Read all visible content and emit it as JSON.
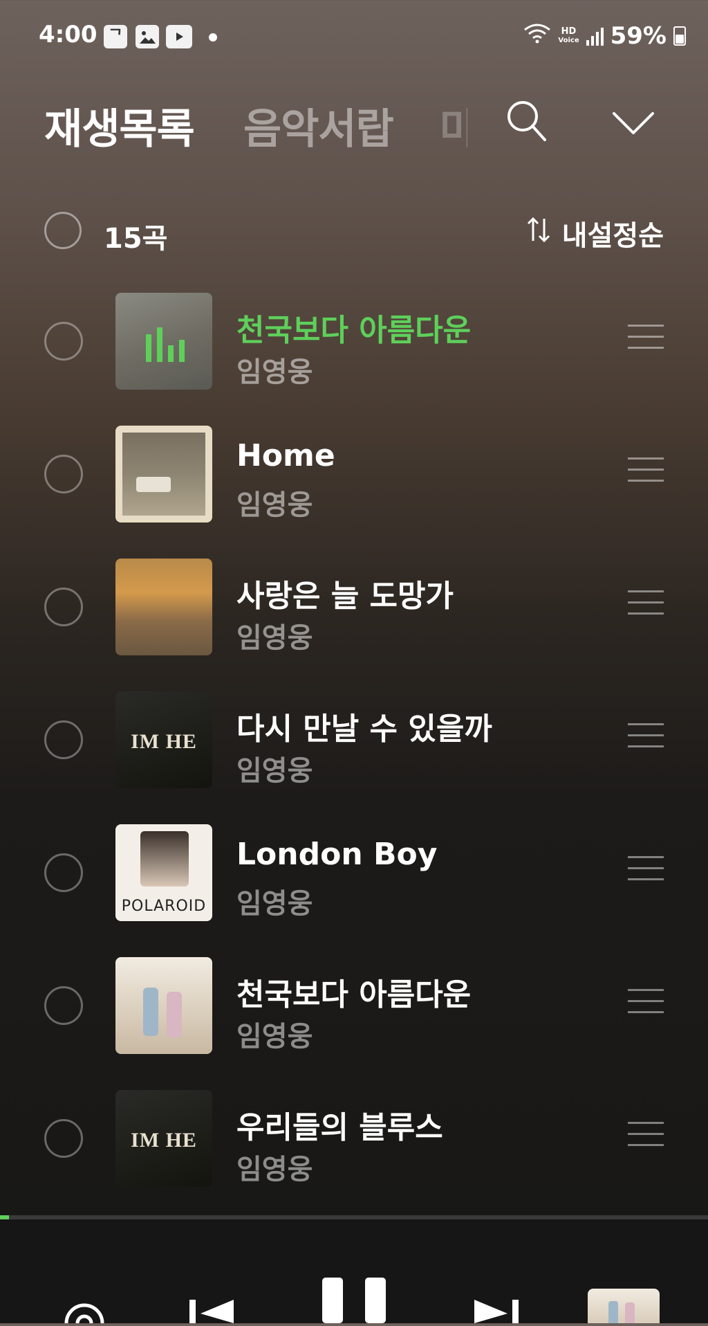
{
  "status_bar": {
    "time": "4:00",
    "app_icons": [
      "tv-icon",
      "gallery-icon",
      "youtube-icon"
    ],
    "hd_label_1": "HD",
    "hd_label_2": "Voice",
    "battery": "59%"
  },
  "tabs": [
    {
      "label": "재생목록"
    },
    {
      "label": "음악서랍"
    },
    {
      "label": "마"
    }
  ],
  "list_header": {
    "count": "15곡",
    "sort_label": "내설정순"
  },
  "progress": {
    "fraction": 0.013
  },
  "colors": {
    "accent": "#5ed05a"
  },
  "tracks": [
    {
      "title": "천국보다 아름다운",
      "artist": "임영웅",
      "playing": true
    },
    {
      "title": "Home",
      "artist": "임영웅"
    },
    {
      "title": "사랑은 늘 도망가",
      "artist": "임영웅"
    },
    {
      "title": "다시 만날 수 있을까",
      "artist": "임영웅",
      "art_text": "IM HE"
    },
    {
      "title": "London Boy",
      "artist": "임영웅",
      "art_text": "POLAROID"
    },
    {
      "title": "천국보다 아름다운",
      "artist": "임영웅"
    },
    {
      "title": "우리들의 블루스",
      "artist": "임영웅",
      "art_text": "IM HE"
    }
  ]
}
